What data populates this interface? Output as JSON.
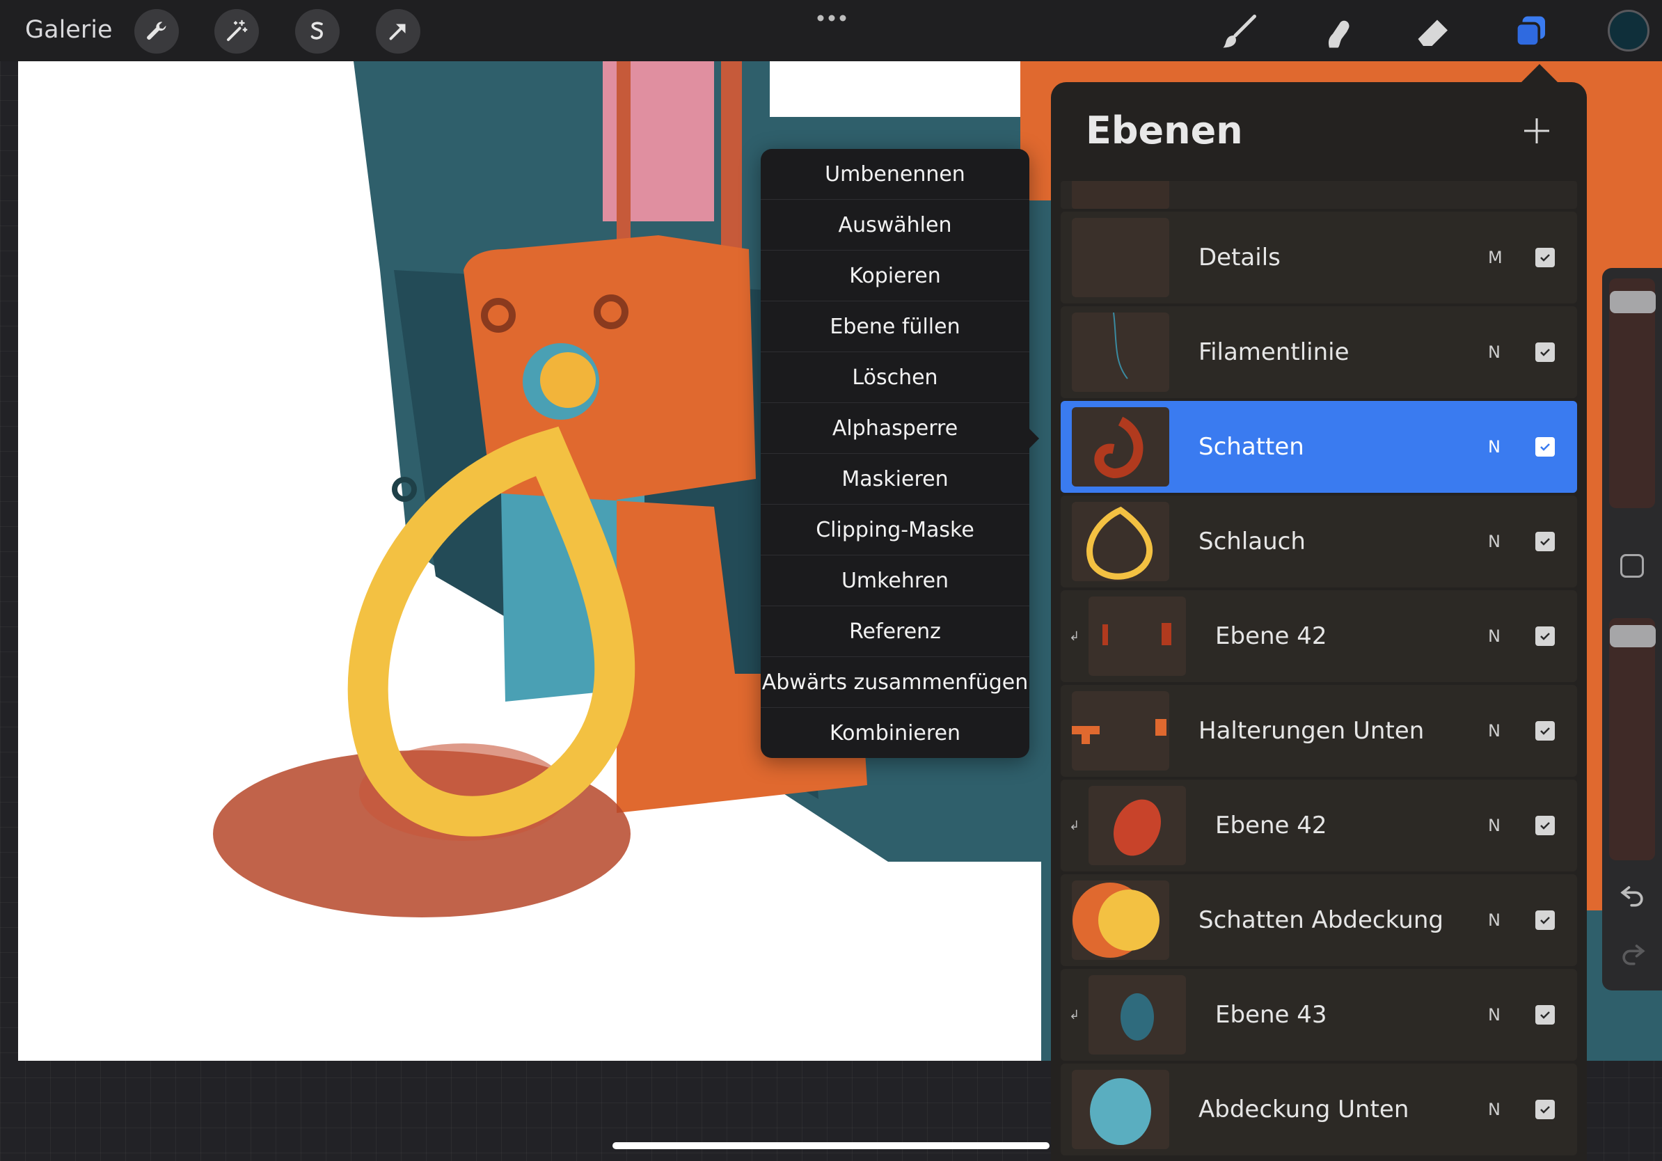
{
  "topbar": {
    "gallery_label": "Galerie",
    "left_tools": [
      "wrench-icon",
      "magic-wand-icon",
      "selection-icon",
      "transform-arrow-icon"
    ],
    "right_tools": [
      "brush-icon",
      "smudge-icon",
      "eraser-icon",
      "layers-icon"
    ],
    "current_color": "#0f2f3a",
    "accent": "#3a7bf0"
  },
  "context_menu": {
    "items": [
      "Umbenennen",
      "Auswählen",
      "Kopieren",
      "Ebene füllen",
      "Löschen",
      "Alphasperre",
      "Maskieren",
      "Clipping-Maske",
      "Umkehren",
      "Referenz",
      "Abwärts zusammenfügen",
      "Kombinieren"
    ]
  },
  "layers": {
    "title": "Ebenen",
    "rows": [
      {
        "name": "Details",
        "blend": "M",
        "visible": true
      },
      {
        "name": "Filamentlinie",
        "blend": "N",
        "visible": true
      },
      {
        "name": "Schatten",
        "blend": "N",
        "visible": true,
        "selected": true
      },
      {
        "name": "Schlauch",
        "blend": "N",
        "visible": true
      },
      {
        "name": "Ebene 42",
        "blend": "N",
        "visible": true,
        "clipped": true
      },
      {
        "name": "Halterungen Unten",
        "blend": "N",
        "visible": true
      },
      {
        "name": "Ebene 42",
        "blend": "N",
        "visible": true,
        "clipped": true
      },
      {
        "name": "Schatten Abdeckung",
        "blend": "N",
        "visible": true
      },
      {
        "name": "Ebene 43",
        "blend": "N",
        "visible": true,
        "clipped": true
      },
      {
        "name": "Abdeckung Unten",
        "blend": "N",
        "visible": true
      }
    ]
  }
}
